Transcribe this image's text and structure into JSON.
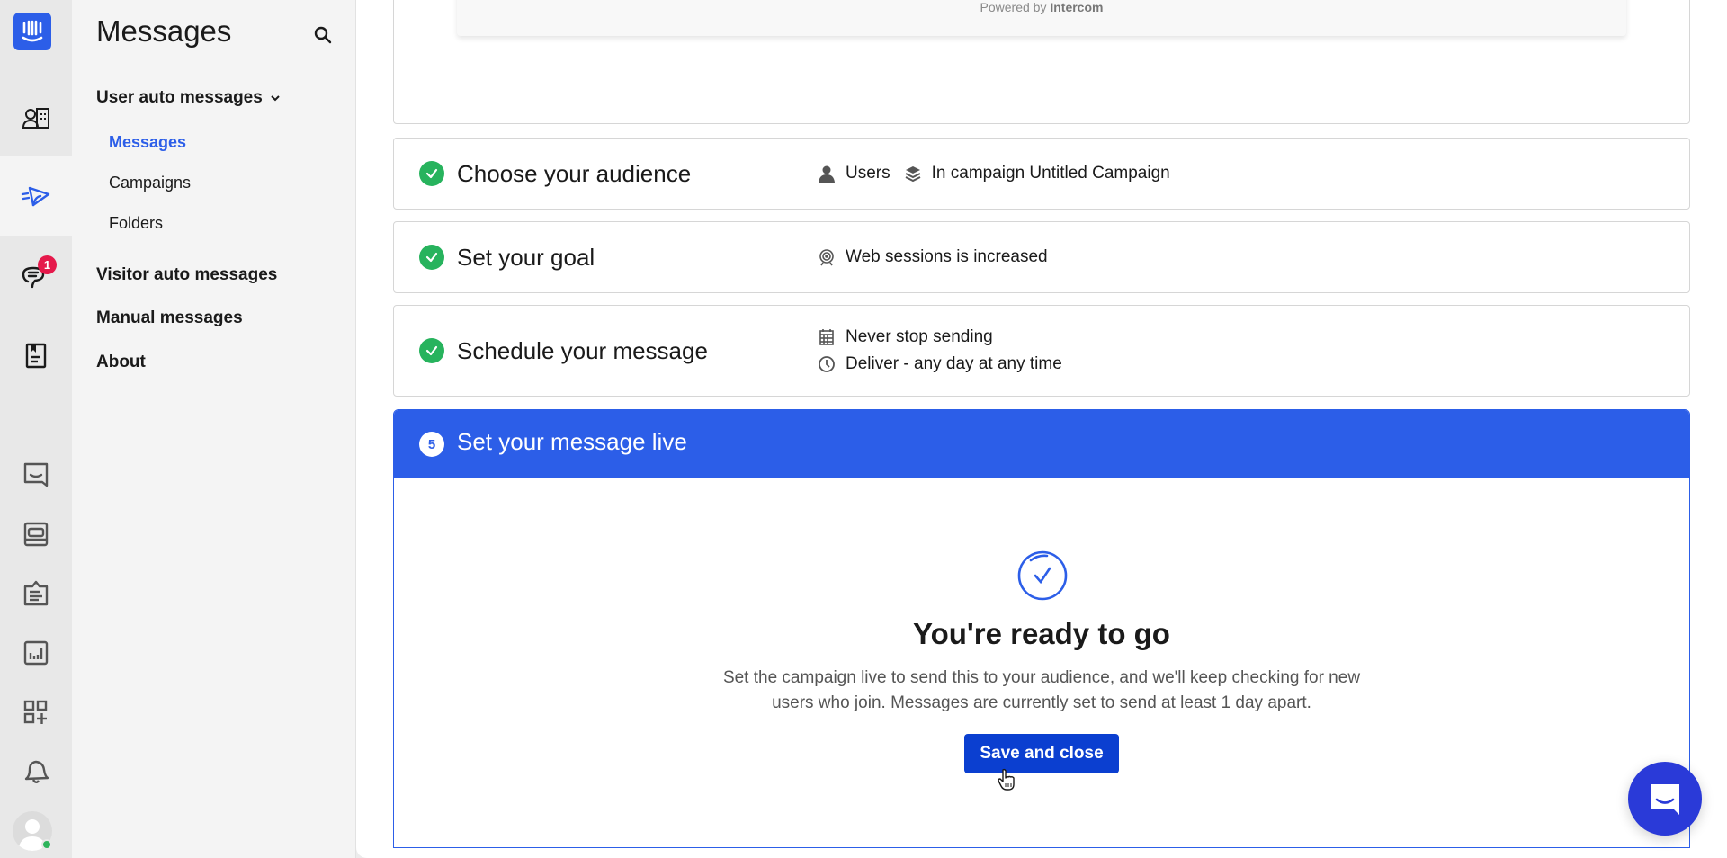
{
  "rail": {
    "items": [
      {
        "name": "contacts",
        "icon": "contacts-icon"
      },
      {
        "name": "outbound",
        "icon": "send-icon",
        "active": true
      },
      {
        "name": "inbox",
        "icon": "chat-icon",
        "badge": "1"
      },
      {
        "name": "articles",
        "icon": "article-icon"
      },
      {
        "name": "messenger",
        "icon": "messenger-icon"
      },
      {
        "name": "operator",
        "icon": "operator-icon"
      },
      {
        "name": "tasks",
        "icon": "clipboard-icon"
      },
      {
        "name": "reports",
        "icon": "reports-icon"
      },
      {
        "name": "apps",
        "icon": "apps-icon"
      },
      {
        "name": "notifications",
        "icon": "bell-icon"
      }
    ]
  },
  "subnav": {
    "title": "Messages",
    "group_user": "User auto messages",
    "sub_items": [
      "Messages",
      "Campaigns",
      "Folders"
    ],
    "active_sub": "Messages",
    "group_visitor": "Visitor auto messages",
    "group_manual": "Manual messages",
    "group_about": "About"
  },
  "preview": {
    "powered_prefix": "Powered by",
    "powered_brand": "Intercom"
  },
  "steps": [
    {
      "title": "Choose your audience",
      "status": "complete",
      "meta": [
        {
          "icon": "user-icon",
          "text": "Users"
        },
        {
          "icon": "layers-icon",
          "text": "In campaign Untitled Campaign"
        }
      ]
    },
    {
      "title": "Set your goal",
      "status": "complete",
      "meta": [
        {
          "icon": "target-icon",
          "text": "Web sessions is increased"
        }
      ]
    },
    {
      "title": "Schedule your message",
      "status": "complete",
      "meta": [
        {
          "icon": "calendar-icon",
          "text": "Never stop sending"
        },
        {
          "icon": "clock-icon",
          "text": "Deliver - any day at any time"
        }
      ]
    }
  ],
  "live": {
    "number": "5",
    "title": "Set your message live",
    "ready_title": "You're ready to go",
    "ready_desc_line1": "Set the campaign live to send this to your audience, and we'll keep checking for new",
    "ready_desc_line2": "users who join. Messages are currently set to send at least 1 day apart.",
    "save_label": "Save and close"
  },
  "colors": {
    "accent": "#2c5ee8",
    "button": "#0b3fd0",
    "success": "#27b35d",
    "badge": "#e5194b",
    "messenger": "#2a3ad8"
  }
}
